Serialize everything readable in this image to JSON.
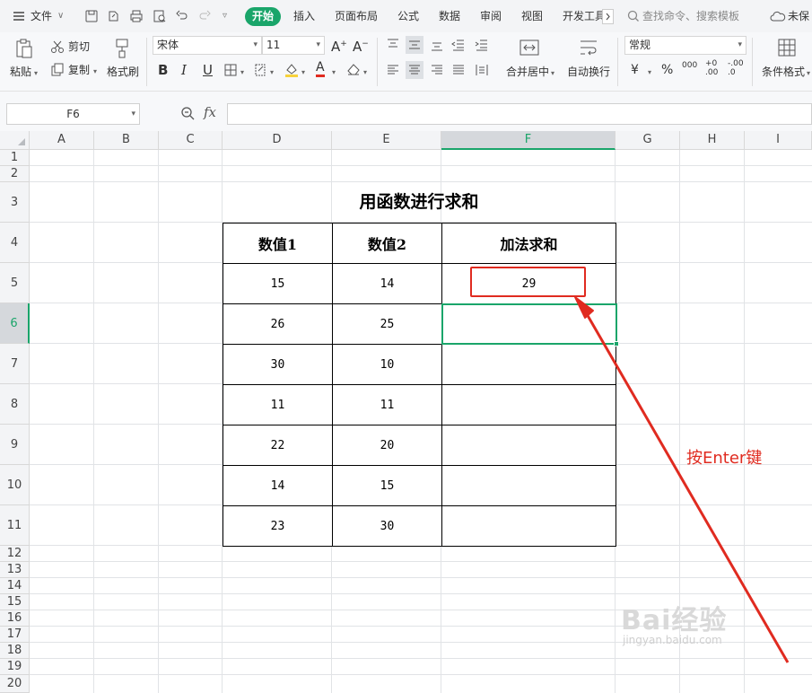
{
  "menubar": {
    "file_label": "文件",
    "tabs": [
      {
        "label": "开始",
        "active": true
      },
      {
        "label": "插入"
      },
      {
        "label": "页面布局"
      },
      {
        "label": "公式"
      },
      {
        "label": "数据"
      },
      {
        "label": "审阅"
      },
      {
        "label": "视图"
      },
      {
        "label": "开发工具"
      }
    ],
    "search_placeholder": "查找命令、搜索模板",
    "cloud_status": "未保"
  },
  "ribbon": {
    "paste": "粘贴",
    "cut": "剪切",
    "copy": "复制",
    "format_painter": "格式刷",
    "font_name": "宋体",
    "font_size": "11",
    "bold": "B",
    "italic": "I",
    "underline": "U",
    "font_color_glyph": "A",
    "merge_center": "合并居中",
    "wrap_text": "自动换行",
    "number_format": "常规",
    "currency": "¥",
    "percent": "%",
    "thousands": "000",
    "inc_decimal": "+0 .00",
    "dec_decimal": "-.00 .0",
    "cond_format": "条件格式"
  },
  "formula_bar": {
    "name_box": "F6",
    "fx": "fx",
    "content": ""
  },
  "grid": {
    "columns": [
      "A",
      "B",
      "C",
      "D",
      "E",
      "F",
      "G",
      "H",
      "I"
    ],
    "rows": [
      "1",
      "2",
      "3",
      "4",
      "5",
      "6",
      "7",
      "8",
      "9",
      "10",
      "11",
      "12",
      "13",
      "14",
      "15",
      "16",
      "17",
      "18",
      "19",
      "20"
    ],
    "active_column": "F",
    "active_row": "6"
  },
  "table": {
    "title": "用函数进行求和",
    "headers": [
      "数值1",
      "数值2",
      "加法求和"
    ],
    "rows": [
      [
        "15",
        "14",
        "29"
      ],
      [
        "26",
        "25",
        ""
      ],
      [
        "30",
        "10",
        ""
      ],
      [
        "11",
        "11",
        ""
      ],
      [
        "22",
        "20",
        ""
      ],
      [
        "14",
        "15",
        ""
      ],
      [
        "23",
        "30",
        ""
      ]
    ]
  },
  "annotation": {
    "text": "按Enter键",
    "color": "#e02b20"
  },
  "watermark": {
    "main": "Bai经验",
    "sub": "jingyan.baidu.com"
  },
  "colors": {
    "accent": "#1aa56a",
    "annotation": "#e02b20"
  }
}
